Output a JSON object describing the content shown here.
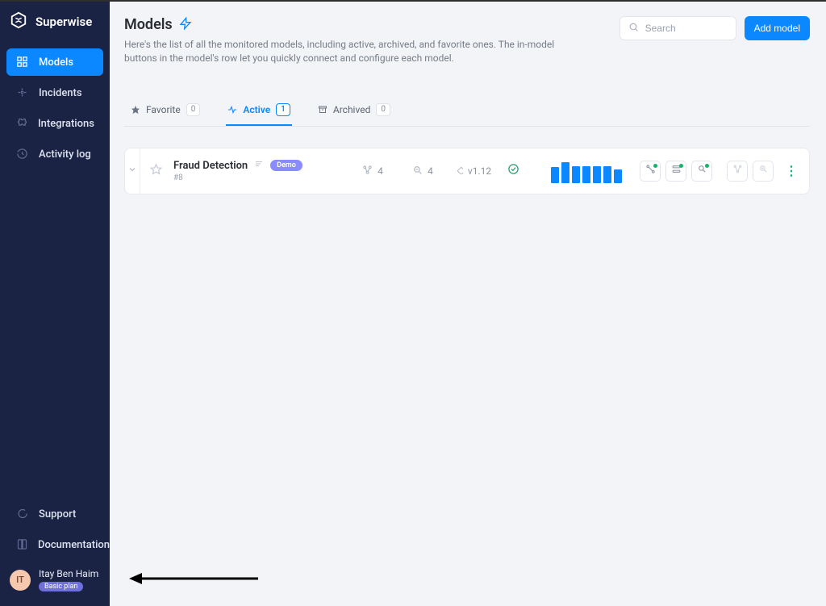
{
  "brand": "Superwise",
  "sidebar": {
    "items": [
      {
        "label": "Models"
      },
      {
        "label": "Incidents"
      },
      {
        "label": "Integrations"
      },
      {
        "label": "Activity log"
      }
    ],
    "bottom": [
      {
        "label": "Support"
      },
      {
        "label": "Documentation"
      }
    ]
  },
  "user": {
    "initials": "IT",
    "name": "Itay Ben Haim",
    "plan": "Basic plan"
  },
  "page": {
    "title": "Models",
    "subtitle": "Here's the list of all the monitored models, including active, archived, and favorite ones. The in-model buttons in the model's row let you quickly connect and configure each model."
  },
  "search": {
    "placeholder": "Search"
  },
  "actions": {
    "add_model": "Add model"
  },
  "tabs": [
    {
      "label": "Favorite",
      "count": "0"
    },
    {
      "label": "Active",
      "count": "1"
    },
    {
      "label": "Archived",
      "count": "0"
    }
  ],
  "models": [
    {
      "name": "Fraud Detection",
      "id": "#8",
      "demo_label": "Demo",
      "stats": {
        "group": "4",
        "search": "4",
        "version": "v1.12"
      }
    }
  ],
  "chart_data": {
    "type": "bar",
    "title": "Model activity sparkline",
    "categories": [
      "1",
      "2",
      "3",
      "4",
      "5",
      "6",
      "7"
    ],
    "values": [
      20,
      26,
      21,
      21,
      21,
      21,
      17
    ],
    "ylim": [
      0,
      30
    ]
  },
  "colors": {
    "accent": "#0b87ff",
    "sidebar": "#1a2344",
    "success": "#18b26b",
    "demo": "#8a8bff"
  }
}
